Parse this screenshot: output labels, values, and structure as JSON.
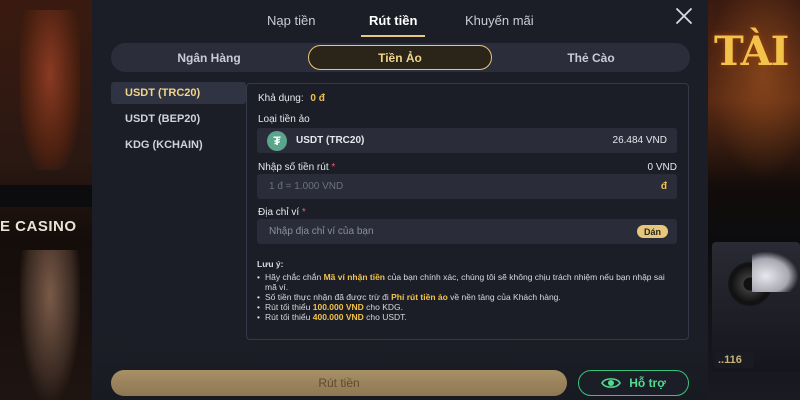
{
  "background": {
    "left_text": "E CASINO",
    "right_text": "TÀI",
    "right_number": "..116"
  },
  "top_tabs": [
    {
      "label": "Nạp tiền",
      "active": false
    },
    {
      "label": "Rút tiền",
      "active": true
    },
    {
      "label": "Khuyến mãi",
      "active": false
    }
  ],
  "segments": [
    {
      "label": "Ngân Hàng",
      "active": false
    },
    {
      "label": "Tiền Ảo",
      "active": true
    },
    {
      "label": "Thẻ Cào",
      "active": false
    }
  ],
  "side_items": [
    {
      "label": "USDT (TRC20)",
      "active": true
    },
    {
      "label": "USDT (BEP20)",
      "active": false
    },
    {
      "label": "KDG (KCHAIN)",
      "active": false
    }
  ],
  "form": {
    "balance_label": "Khả dụng:",
    "balance_value": "0 đ",
    "coin_type_label": "Loại tiền ảo",
    "coin_symbol": "₮",
    "coin_name": "USDT (TRC20)",
    "coin_rate": "26.484 VND",
    "amount_label": "Nhập số tiền rút",
    "required_mark": "*",
    "amount_converted": "0 VND",
    "amount_placeholder": "1 đ = 1.000 VND",
    "amount_unit": "đ",
    "address_label": "Địa chỉ ví",
    "address_placeholder": "Nhập địa chỉ ví của bạn",
    "paste_label": "Dán"
  },
  "notes": {
    "title": "Lưu ý:",
    "items": [
      {
        "pre": "Hãy chắc chắn ",
        "highlight": "Mã ví nhận tiền",
        "post": " của bạn chính xác, chúng tôi sẽ không chịu trách nhiệm nếu bạn nhập sai mã ví."
      },
      {
        "pre": "Số tiền thực nhận đã được trừ đi ",
        "highlight": "Phí rút tiền ảo",
        "post": " về nền tảng của Khách hàng."
      },
      {
        "pre": "Rút tối thiểu ",
        "highlight": "100.000 VND",
        "post": " cho KDG."
      },
      {
        "pre": "Rút tối thiểu ",
        "highlight": "400.000 VND",
        "post": " cho USDT."
      }
    ]
  },
  "buttons": {
    "withdraw": "Rút tiền",
    "support": "Hỗ trợ"
  },
  "colors": {
    "accent_gold": "#e7c77b",
    "highlight_gold": "#f0c24d",
    "support_green": "#36c47a",
    "required_red": "#e85a6a",
    "coin_teal": "#5aa58c"
  },
  "icons": {
    "close": "close-icon",
    "coin": "tether-icon",
    "support": "eye-support-icon"
  }
}
